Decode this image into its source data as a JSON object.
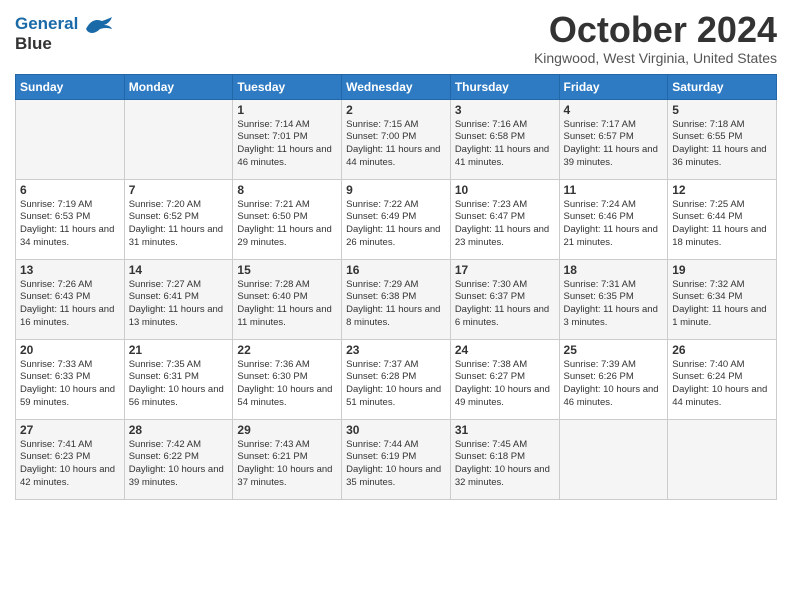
{
  "header": {
    "logo_line1": "General",
    "logo_line2": "Blue",
    "month": "October 2024",
    "location": "Kingwood, West Virginia, United States"
  },
  "days_of_week": [
    "Sunday",
    "Monday",
    "Tuesday",
    "Wednesday",
    "Thursday",
    "Friday",
    "Saturday"
  ],
  "rows": [
    [
      {
        "day": "",
        "info": ""
      },
      {
        "day": "",
        "info": ""
      },
      {
        "day": "1",
        "info": "Sunrise: 7:14 AM\nSunset: 7:01 PM\nDaylight: 11 hours and 46 minutes."
      },
      {
        "day": "2",
        "info": "Sunrise: 7:15 AM\nSunset: 7:00 PM\nDaylight: 11 hours and 44 minutes."
      },
      {
        "day": "3",
        "info": "Sunrise: 7:16 AM\nSunset: 6:58 PM\nDaylight: 11 hours and 41 minutes."
      },
      {
        "day": "4",
        "info": "Sunrise: 7:17 AM\nSunset: 6:57 PM\nDaylight: 11 hours and 39 minutes."
      },
      {
        "day": "5",
        "info": "Sunrise: 7:18 AM\nSunset: 6:55 PM\nDaylight: 11 hours and 36 minutes."
      }
    ],
    [
      {
        "day": "6",
        "info": "Sunrise: 7:19 AM\nSunset: 6:53 PM\nDaylight: 11 hours and 34 minutes."
      },
      {
        "day": "7",
        "info": "Sunrise: 7:20 AM\nSunset: 6:52 PM\nDaylight: 11 hours and 31 minutes."
      },
      {
        "day": "8",
        "info": "Sunrise: 7:21 AM\nSunset: 6:50 PM\nDaylight: 11 hours and 29 minutes."
      },
      {
        "day": "9",
        "info": "Sunrise: 7:22 AM\nSunset: 6:49 PM\nDaylight: 11 hours and 26 minutes."
      },
      {
        "day": "10",
        "info": "Sunrise: 7:23 AM\nSunset: 6:47 PM\nDaylight: 11 hours and 23 minutes."
      },
      {
        "day": "11",
        "info": "Sunrise: 7:24 AM\nSunset: 6:46 PM\nDaylight: 11 hours and 21 minutes."
      },
      {
        "day": "12",
        "info": "Sunrise: 7:25 AM\nSunset: 6:44 PM\nDaylight: 11 hours and 18 minutes."
      }
    ],
    [
      {
        "day": "13",
        "info": "Sunrise: 7:26 AM\nSunset: 6:43 PM\nDaylight: 11 hours and 16 minutes."
      },
      {
        "day": "14",
        "info": "Sunrise: 7:27 AM\nSunset: 6:41 PM\nDaylight: 11 hours and 13 minutes."
      },
      {
        "day": "15",
        "info": "Sunrise: 7:28 AM\nSunset: 6:40 PM\nDaylight: 11 hours and 11 minutes."
      },
      {
        "day": "16",
        "info": "Sunrise: 7:29 AM\nSunset: 6:38 PM\nDaylight: 11 hours and 8 minutes."
      },
      {
        "day": "17",
        "info": "Sunrise: 7:30 AM\nSunset: 6:37 PM\nDaylight: 11 hours and 6 minutes."
      },
      {
        "day": "18",
        "info": "Sunrise: 7:31 AM\nSunset: 6:35 PM\nDaylight: 11 hours and 3 minutes."
      },
      {
        "day": "19",
        "info": "Sunrise: 7:32 AM\nSunset: 6:34 PM\nDaylight: 11 hours and 1 minute."
      }
    ],
    [
      {
        "day": "20",
        "info": "Sunrise: 7:33 AM\nSunset: 6:33 PM\nDaylight: 10 hours and 59 minutes."
      },
      {
        "day": "21",
        "info": "Sunrise: 7:35 AM\nSunset: 6:31 PM\nDaylight: 10 hours and 56 minutes."
      },
      {
        "day": "22",
        "info": "Sunrise: 7:36 AM\nSunset: 6:30 PM\nDaylight: 10 hours and 54 minutes."
      },
      {
        "day": "23",
        "info": "Sunrise: 7:37 AM\nSunset: 6:28 PM\nDaylight: 10 hours and 51 minutes."
      },
      {
        "day": "24",
        "info": "Sunrise: 7:38 AM\nSunset: 6:27 PM\nDaylight: 10 hours and 49 minutes."
      },
      {
        "day": "25",
        "info": "Sunrise: 7:39 AM\nSunset: 6:26 PM\nDaylight: 10 hours and 46 minutes."
      },
      {
        "day": "26",
        "info": "Sunrise: 7:40 AM\nSunset: 6:24 PM\nDaylight: 10 hours and 44 minutes."
      }
    ],
    [
      {
        "day": "27",
        "info": "Sunrise: 7:41 AM\nSunset: 6:23 PM\nDaylight: 10 hours and 42 minutes."
      },
      {
        "day": "28",
        "info": "Sunrise: 7:42 AM\nSunset: 6:22 PM\nDaylight: 10 hours and 39 minutes."
      },
      {
        "day": "29",
        "info": "Sunrise: 7:43 AM\nSunset: 6:21 PM\nDaylight: 10 hours and 37 minutes."
      },
      {
        "day": "30",
        "info": "Sunrise: 7:44 AM\nSunset: 6:19 PM\nDaylight: 10 hours and 35 minutes."
      },
      {
        "day": "31",
        "info": "Sunrise: 7:45 AM\nSunset: 6:18 PM\nDaylight: 10 hours and 32 minutes."
      },
      {
        "day": "",
        "info": ""
      },
      {
        "day": "",
        "info": ""
      }
    ]
  ]
}
